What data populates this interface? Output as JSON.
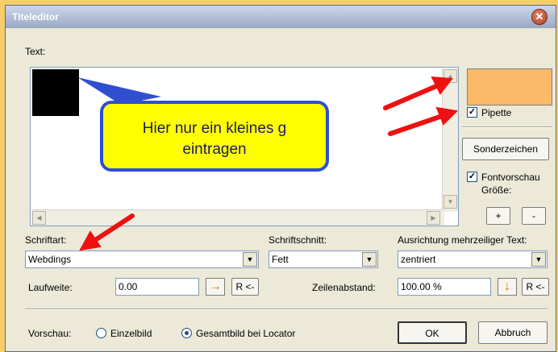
{
  "window": {
    "title": "Titeleditor"
  },
  "text_section": {
    "label": "Text:"
  },
  "color": {
    "swatch": "#fcb96a",
    "pipette_label": "Pipette",
    "pipette_checked": true
  },
  "buttons": {
    "special_chars": "Sonderzeichen",
    "plus": "+",
    "minus": "-",
    "reset": "R <-",
    "ok": "OK",
    "cancel": "Abbruch"
  },
  "font_preview": {
    "label": "Fontvorschau",
    "checked": true,
    "size_label": "Größe:"
  },
  "font": {
    "label": "Schriftart:",
    "value": "Webdings"
  },
  "style": {
    "label": "Schriftschnitt:",
    "value": "Fett"
  },
  "alignment": {
    "label": "Ausrichtung mehrzeiliger Text:",
    "value": "zentriert"
  },
  "tracking": {
    "label": "Laufweite:",
    "value": "0.00"
  },
  "line_spacing": {
    "label": "Zeilenabstand:",
    "value": "100.00 %"
  },
  "preview": {
    "label": "Vorschau:",
    "options": [
      "Einzelbild",
      "Gesamtbild bei Locator"
    ],
    "selected": "Gesamtbild bei Locator"
  },
  "annotation": {
    "text_line1": "Hier nur ein kleines g",
    "text_line2": "eintragen"
  },
  "colors": {
    "arrow_red": "#ee1111",
    "callout_bg": "#ffff00",
    "callout_border": "#2f4fd0"
  }
}
